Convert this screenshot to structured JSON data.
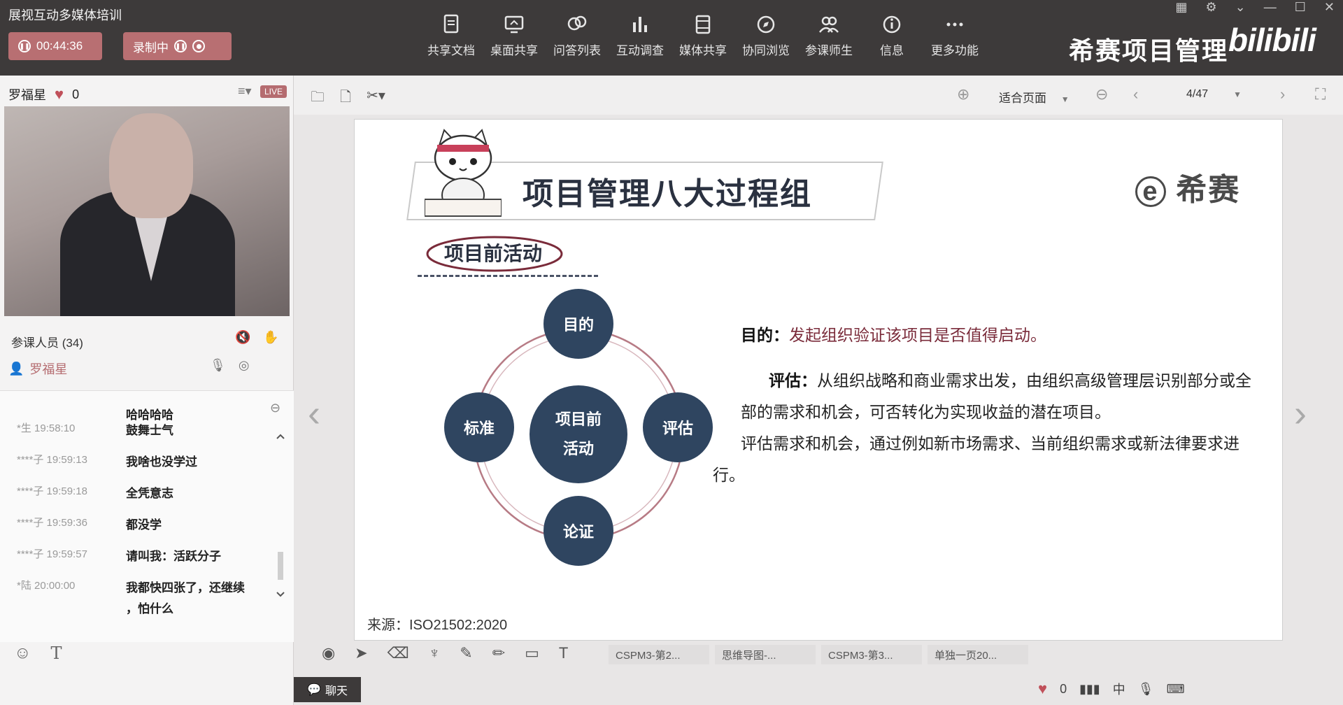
{
  "app": {
    "title": "展视互动多媒体培训"
  },
  "session": {
    "timer": "00:44:36",
    "record_label": "录制中"
  },
  "toolbar": {
    "items": [
      {
        "label": "共享文档",
        "icon": "doc-share-icon"
      },
      {
        "label": "桌面共享",
        "icon": "desktop-share-icon"
      },
      {
        "label": "问答列表",
        "icon": "qa-list-icon"
      },
      {
        "label": "互动调查",
        "icon": "survey-icon"
      },
      {
        "label": "媒体共享",
        "icon": "media-share-icon"
      },
      {
        "label": "协同浏览",
        "icon": "co-browse-icon"
      },
      {
        "label": "参课师生",
        "icon": "participants-icon"
      },
      {
        "label": "信息",
        "icon": "info-icon"
      },
      {
        "label": "更多功能",
        "icon": "more-icon"
      }
    ]
  },
  "brand": {
    "name": "希赛项目管理",
    "logo_text": "bilibili"
  },
  "presenter": {
    "name": "罗福星",
    "likes": "0",
    "live": "LIVE"
  },
  "attendees": {
    "label": "参课人员 (34)",
    "speaker": "罗福星"
  },
  "chat": {
    "messages": [
      {
        "meta": "",
        "text": "哈哈哈哈",
        "partial": true
      },
      {
        "meta": "*生  19:58:10",
        "text": "鼓舞士气"
      },
      {
        "meta": "****子  19:59:13",
        "text": "我啥也没学过"
      },
      {
        "meta": "****子  19:59:18",
        "text": "全凭意志"
      },
      {
        "meta": "****子  19:59:36",
        "text": "都没学"
      },
      {
        "meta": "****子  19:59:57",
        "text": "请叫我：活跃分子"
      },
      {
        "meta": "*陆  20:00:00",
        "text": "我都快四张了，还继续"
      },
      {
        "meta": "",
        "text": "，怕什么"
      }
    ],
    "button_label": "聊天"
  },
  "doc": {
    "zoom": "适合页面",
    "page": "4/47"
  },
  "slide": {
    "title": "项目管理八大过程组",
    "subtitle": "项目前活动",
    "logo": "希赛",
    "diagram": {
      "center": "项目前活动",
      "top": "目的",
      "left": "标准",
      "right": "评估",
      "bottom": "论证"
    },
    "para_purpose_label": "目的：",
    "para_purpose": "发起组织验证该项目是否值得启动。",
    "para_eval_label": "评估：",
    "para_eval": "从组织战略和商业需求出发，由组织高级管理层识别部分或全部的需求和机会，可否转化为实现收益的潜在项目。",
    "para_eval2": "评估需求和机会，通过例如新市场需求、当前组织需求或新法律要求进行。",
    "source": "来源：ISO21502:2020"
  },
  "doc_tabs": [
    "CSPM3-第2...",
    "思维导图-...",
    "CSPM3-第3...",
    "单独一页20..."
  ],
  "statusbar": {
    "likes": "0",
    "ime": "中"
  }
}
